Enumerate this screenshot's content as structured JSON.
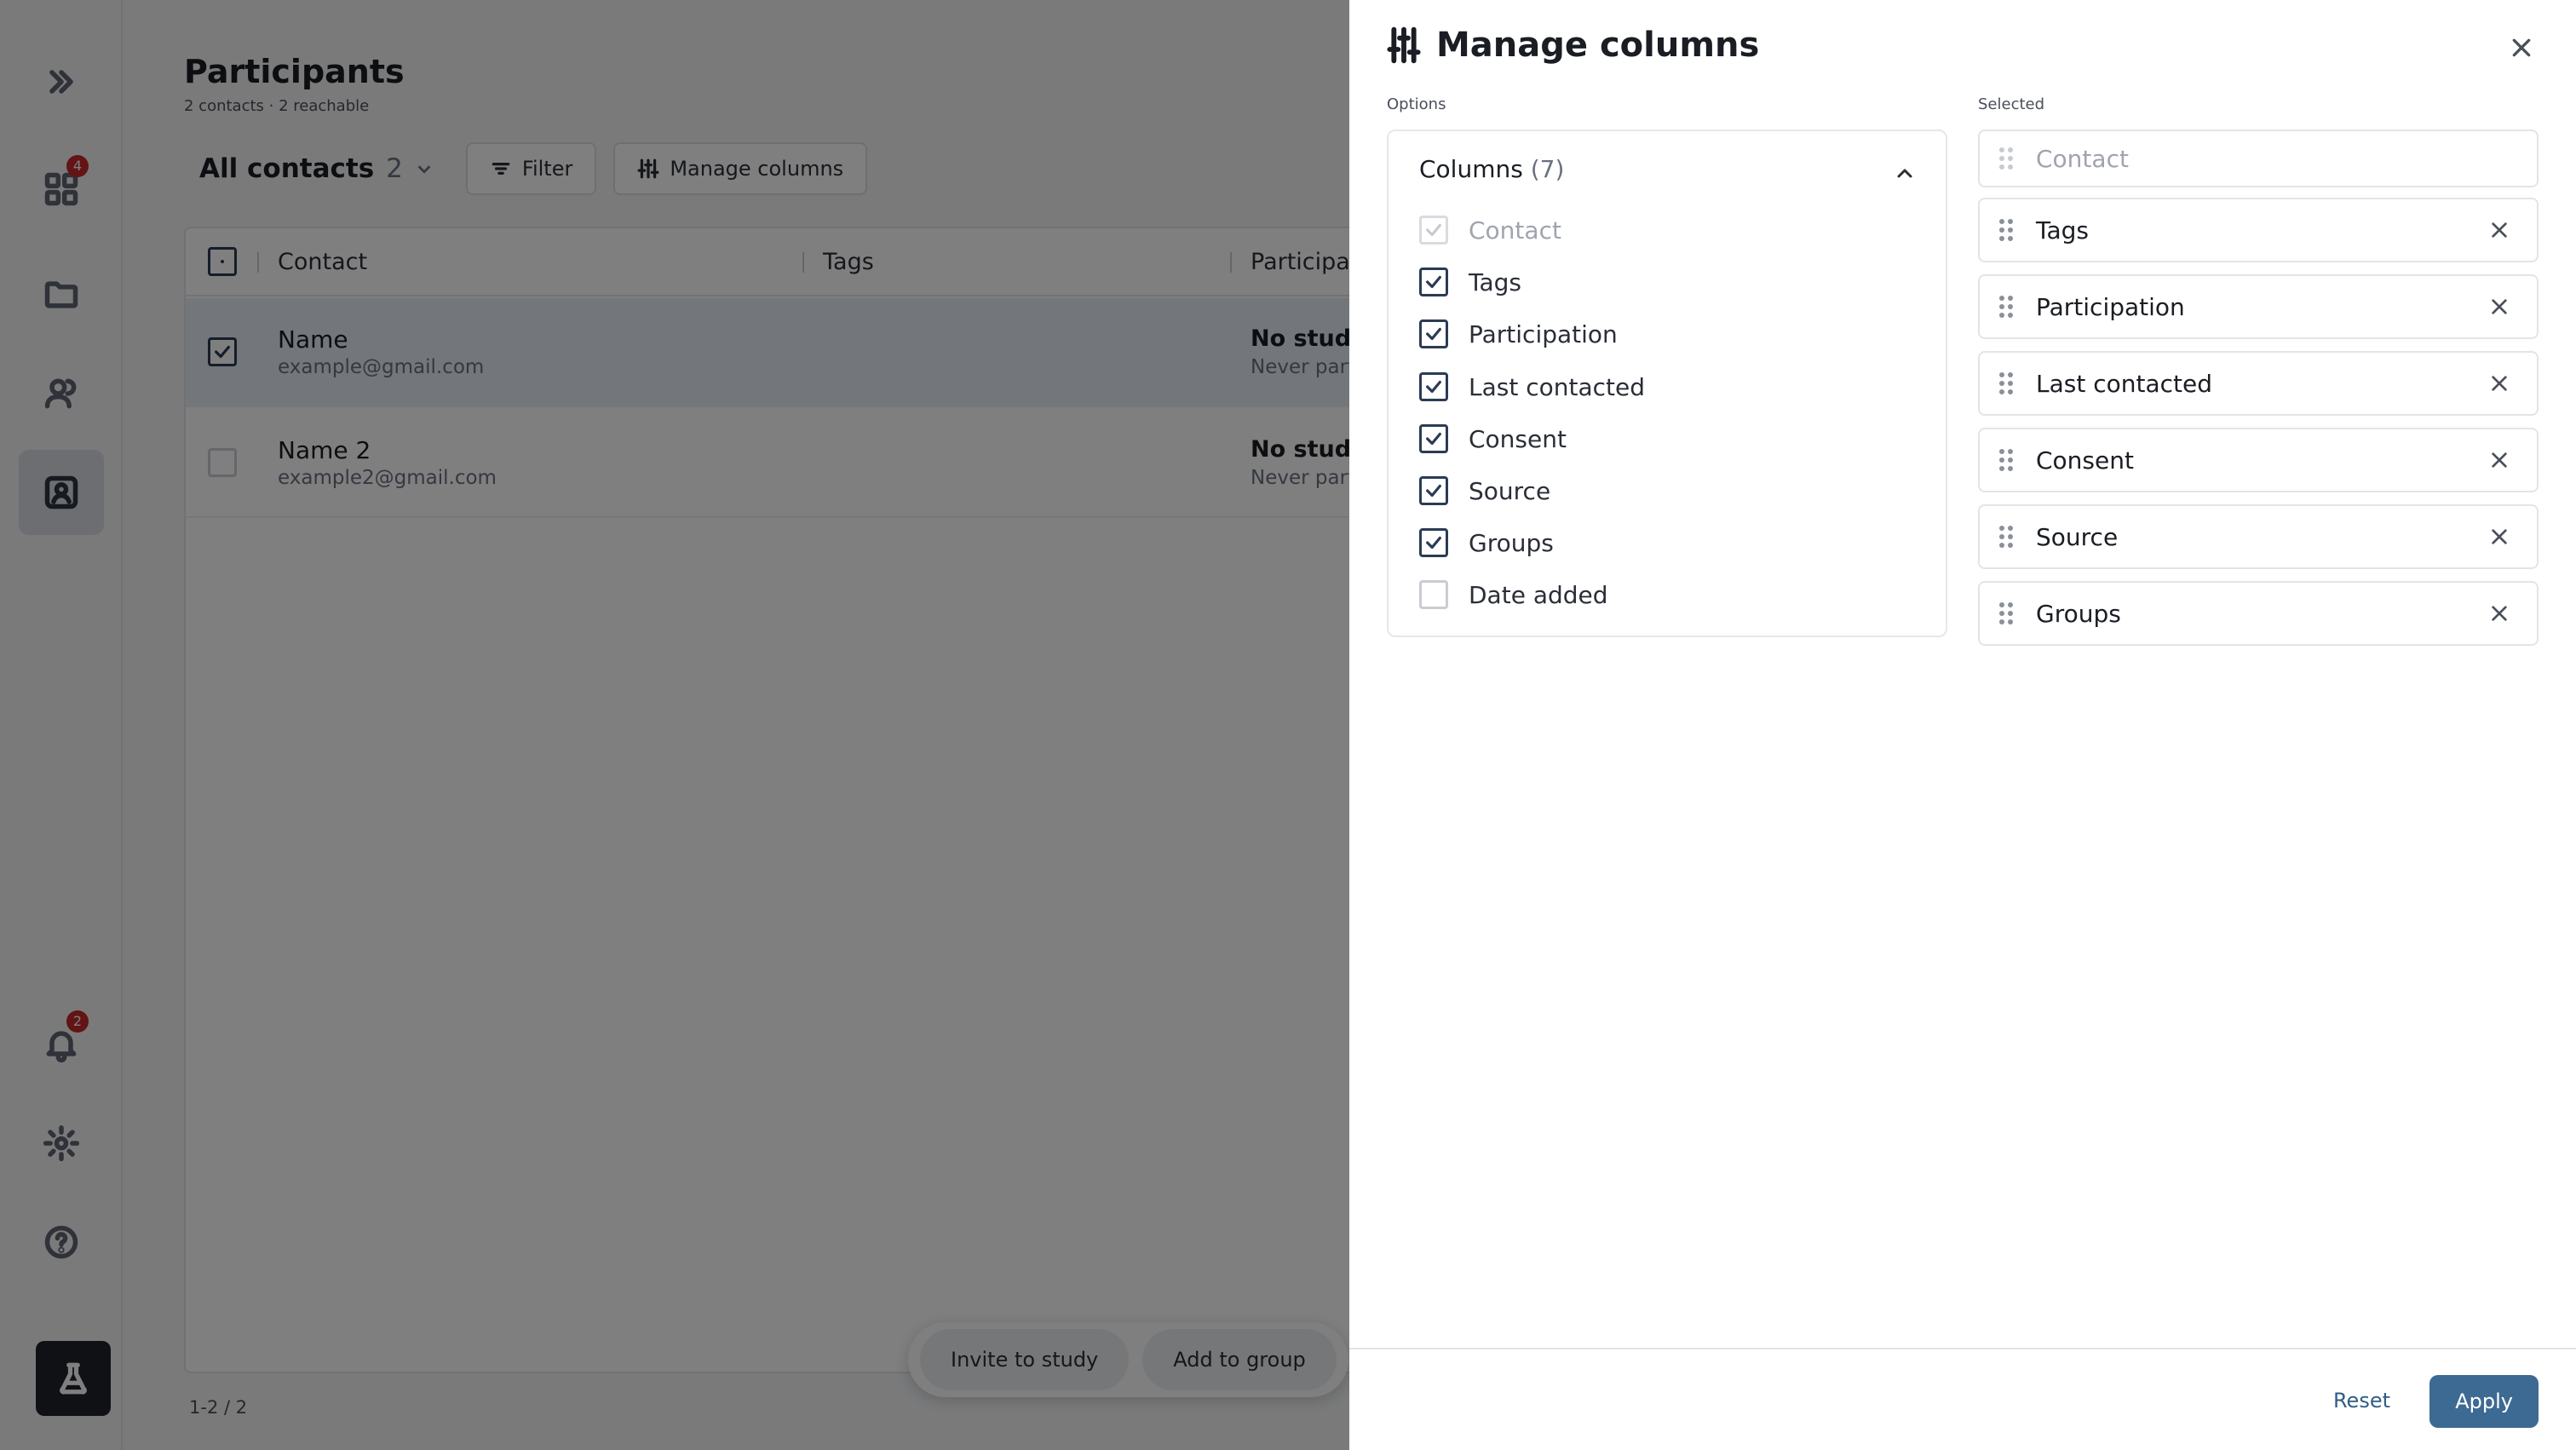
{
  "rail": {
    "apps_badge": "4",
    "notifications_badge": "2"
  },
  "page": {
    "title": "Participants",
    "subtitle": "2 contacts · 2 reachable",
    "view_label": "All contacts",
    "view_count": "2",
    "filter_label": "Filter",
    "manage_columns_label": "Manage columns"
  },
  "table": {
    "headers": [
      "Contact",
      "Tags",
      "Participation"
    ],
    "rows": [
      {
        "name": "Name",
        "email": "example@gmail.com",
        "participation": "No studies",
        "participation_sub": "Never participated",
        "selected": true
      },
      {
        "name": "Name 2",
        "email": "example2@gmail.com",
        "participation": "No studies",
        "participation_sub": "Never participated",
        "selected": false
      }
    ],
    "pager": "1-2 / 2"
  },
  "bulk_actions": [
    "Invite to study",
    "Add to group"
  ],
  "drawer": {
    "title": "Manage columns",
    "options_label": "Options",
    "selected_label": "Selected",
    "columns_heading": "Columns",
    "columns_count": "(7)",
    "options": [
      {
        "label": "Contact",
        "checked": true,
        "disabled": true
      },
      {
        "label": "Tags",
        "checked": true,
        "disabled": false
      },
      {
        "label": "Participation",
        "checked": true,
        "disabled": false
      },
      {
        "label": "Last contacted",
        "checked": true,
        "disabled": false
      },
      {
        "label": "Consent",
        "checked": true,
        "disabled": false
      },
      {
        "label": "Source",
        "checked": true,
        "disabled": false
      },
      {
        "label": "Groups",
        "checked": true,
        "disabled": false
      },
      {
        "label": "Date added",
        "checked": false,
        "disabled": false
      }
    ],
    "selected": [
      {
        "label": "Contact",
        "locked": true
      },
      {
        "label": "Tags",
        "locked": false
      },
      {
        "label": "Participation",
        "locked": false
      },
      {
        "label": "Last contacted",
        "locked": false
      },
      {
        "label": "Consent",
        "locked": false
      },
      {
        "label": "Source",
        "locked": false
      },
      {
        "label": "Groups",
        "locked": false
      }
    ],
    "reset_label": "Reset",
    "apply_label": "Apply"
  },
  "colors": {
    "accent": "#3d6a92",
    "badge": "#c62828",
    "checkbox": "#2b3b55"
  }
}
